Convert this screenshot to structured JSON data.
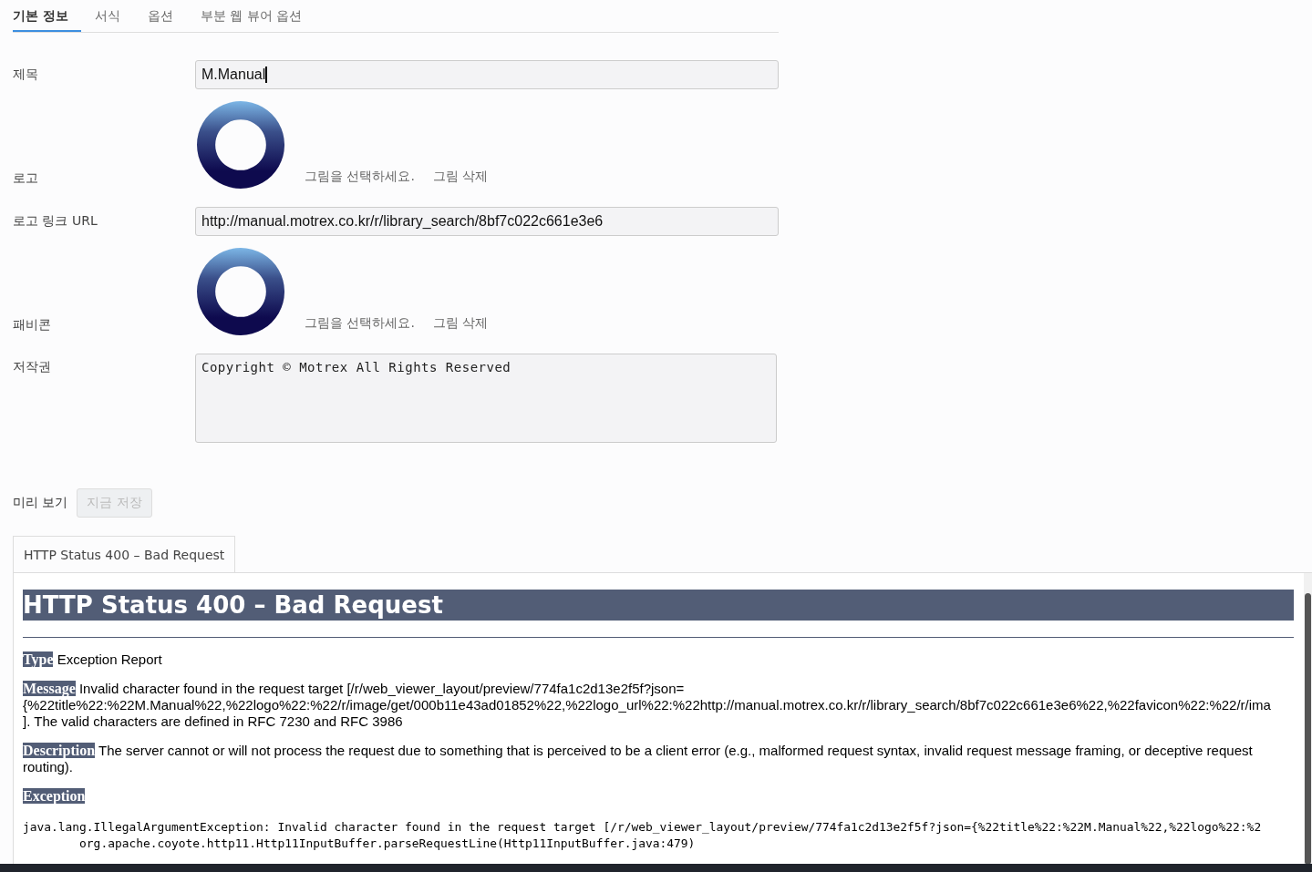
{
  "tabs": [
    {
      "label": "기본 정보",
      "selected": true
    },
    {
      "label": "서식",
      "selected": false
    },
    {
      "label": "옵션",
      "selected": false
    },
    {
      "label": "부분 웹 뷰어 옵션",
      "selected": false
    }
  ],
  "form": {
    "title": {
      "label": "제목",
      "value": "M.Manual"
    },
    "logo": {
      "label": "로고",
      "select": "그림을 선택하세요.",
      "delete": "그림 삭제"
    },
    "logo_url": {
      "label": "로고 링크 URL",
      "value": "http://manual.motrex.co.kr/r/library_search/8bf7c022c661e3e6"
    },
    "favicon": {
      "label": "패비콘",
      "select": "그림을 선택하세요.",
      "delete": "그림 삭제"
    },
    "copyright": {
      "label": "저작권",
      "value": "Copyright © Motrex All Rights Reserved"
    }
  },
  "preview": {
    "label": "미리 보기",
    "save_button": {
      "label": "지금 저장",
      "disabled": true
    },
    "tab": "HTTP Status 400 – Bad Request",
    "page": {
      "heading": "HTTP Status 400 – Bad Request",
      "type": {
        "label": "Type",
        "text": "Exception Report"
      },
      "message": {
        "label": "Message",
        "lines": [
          "Invalid character found in the request target [/r/web_viewer_layout/preview/774fa1c2d13e2f5f?json=",
          "{%22title%22:%22M.Manual%22,%22logo%22:%22/r/image/get/000b11e43ad01852%22,%22logo_url%22:%22http://manual.motrex.co.kr/r/library_search/8bf7c022c661e3e6%22,%22favicon%22:%22/r/ima",
          "]. The valid characters are defined in RFC 7230 and RFC 3986"
        ]
      },
      "description": {
        "label": "Description",
        "text": "The server cannot or will not process the request due to something that is perceived to be a client error (e.g., malformed request syntax, invalid request message framing, or deceptive request routing)."
      },
      "exception": {
        "label": "Exception",
        "lines": [
          "java.lang.IllegalArgumentException: Invalid character found in the request target [/r/web_viewer_layout/preview/774fa1c2d13e2f5f?json={%22title%22:%22M.Manual%22,%22logo%22:%2",
          "\torg.apache.coyote.http11.Http11InputBuffer.parseRequestLine(Http11InputBuffer.java:479)"
        ]
      }
    }
  }
}
